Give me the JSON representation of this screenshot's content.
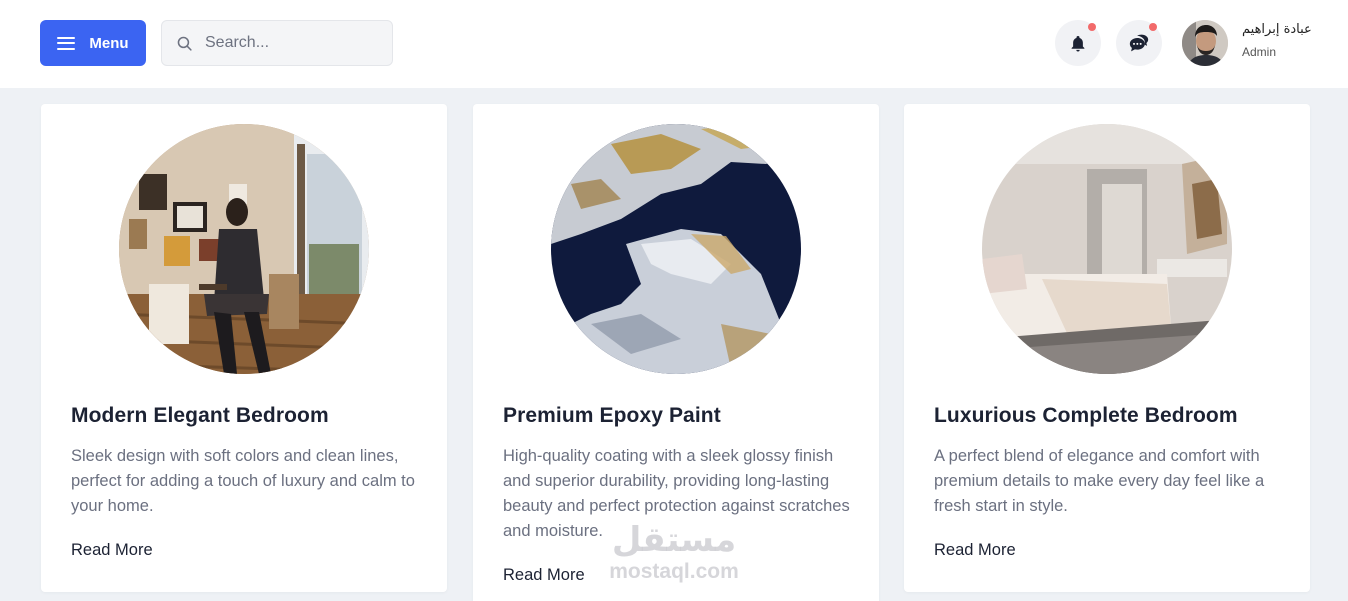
{
  "header": {
    "menu_label": "Menu",
    "search_placeholder": "Search...",
    "user": {
      "name": "عبادة إبراهيم",
      "role": "Admin"
    },
    "notification_dot_color": "#f26a6a",
    "accent_color": "#3b64f2"
  },
  "cards": [
    {
      "title": "Modern Elegant Bedroom",
      "description": "Sleek design with soft colors and clean lines, perfect for adding a touch of luxury and calm to your home.",
      "link": "Read More",
      "image": "man-sitting-in-room-with-framed-art"
    },
    {
      "title": "Premium Epoxy Paint",
      "description": "High-quality coating with a sleek glossy finish and superior durability, providing long-lasting beauty and perfect protection against scratches and moisture.",
      "link": "Read More",
      "image": "epoxy-marble-texture"
    },
    {
      "title": "Luxurious Complete Bedroom",
      "description": "A perfect blend of elegance and comfort with premium details to make every day feel like a fresh start in style.",
      "link": "Read More",
      "image": "modern-bedroom-interior"
    }
  ],
  "watermark": {
    "arabic": "مستقل",
    "latin": "mostaql.com"
  }
}
